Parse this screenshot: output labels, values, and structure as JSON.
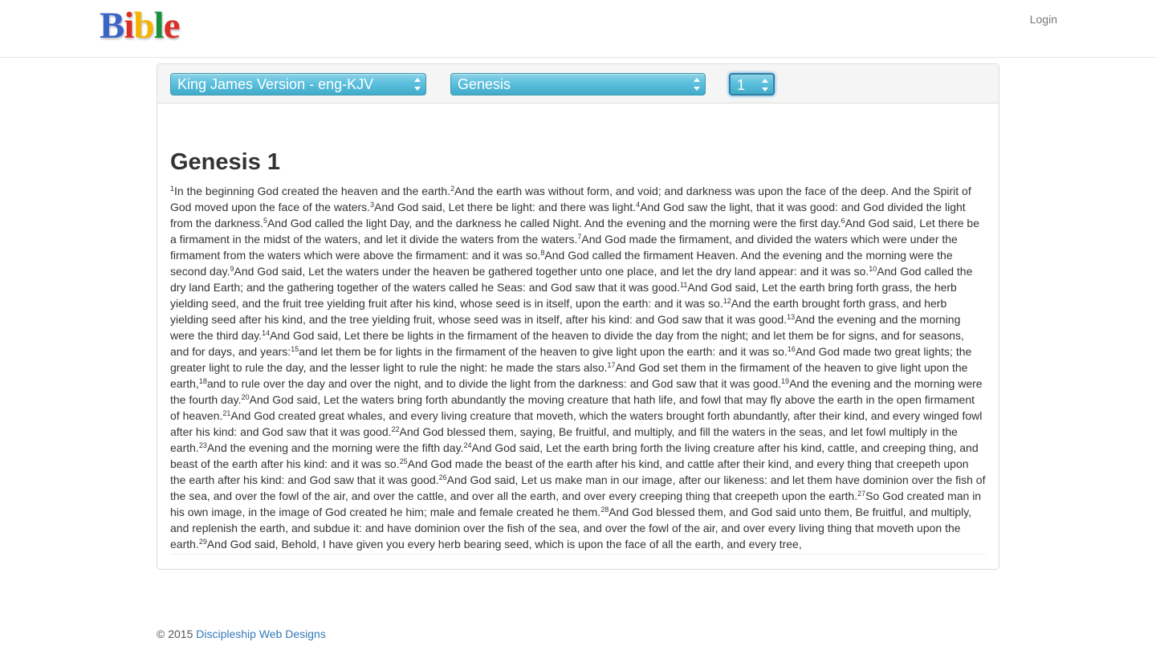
{
  "header": {
    "logo_letters": [
      {
        "ch": "B",
        "color": "#3b64c8"
      },
      {
        "ch": "i",
        "color": "#d93025"
      },
      {
        "ch": "b",
        "color": "#f4b400"
      },
      {
        "ch": "l",
        "color": "#1a8f3c"
      },
      {
        "ch": "e",
        "color": "#d93025"
      }
    ],
    "login_label": "Login"
  },
  "selectors": {
    "version": "King James Version - eng-KJV",
    "book": "Genesis",
    "chapter": "1"
  },
  "chapter_title": "Genesis 1",
  "verses": [
    {
      "n": "1",
      "text": "In the beginning God created the heaven and the earth."
    },
    {
      "n": "2",
      "text": "And the earth was without form, and void; and darkness was upon the face of the deep. And the Spirit of God moved upon the face of the waters."
    },
    {
      "n": "3",
      "text": "And God said, Let there be light: and there was light."
    },
    {
      "n": "4",
      "text": "And God saw the light, that it was good: and God divided the light from the darkness."
    },
    {
      "n": "5",
      "text": "And God called the light Day, and the darkness he called Night. And the evening and the morning were the first day."
    },
    {
      "n": "6",
      "text": "And God said, Let there be a firmament in the midst of the waters, and let it divide the waters from the waters."
    },
    {
      "n": "7",
      "text": "And God made the firmament, and divided the waters which were under the firmament from the waters which were above the firmament: and it was so."
    },
    {
      "n": "8",
      "text": "And God called the firmament Heaven. And the evening and the morning were the second day."
    },
    {
      "n": "9",
      "text": "And God said, Let the waters under the heaven be gathered together unto one place, and let the dry land appear: and it was so."
    },
    {
      "n": "10",
      "text": "And God called the dry land Earth; and the gathering together of the waters called he Seas: and God saw that it was good."
    },
    {
      "n": "11",
      "text": "And God said, Let the earth bring forth grass, the herb yielding seed, and the fruit tree yielding fruit after his kind, whose seed is in itself, upon the earth: and it was so."
    },
    {
      "n": "12",
      "text": "And the earth brought forth grass, and herb yielding seed after his kind, and the tree yielding fruit, whose seed was in itself, after his kind: and God saw that it was good."
    },
    {
      "n": "13",
      "text": "And the evening and the morning were the third day."
    },
    {
      "n": "14",
      "text": "And God said, Let there be lights in the firmament of the heaven to divide the day from the night; and let them be for signs, and for seasons, and for days, and years:"
    },
    {
      "n": "15",
      "text": "and let them be for lights in the firmament of the heaven to give light upon the earth: and it was so."
    },
    {
      "n": "16",
      "text": "And God made two great lights; the greater light to rule the day, and the lesser light to rule the night: he made the stars also."
    },
    {
      "n": "17",
      "text": "And God set them in the firmament of the heaven to give light upon the earth,"
    },
    {
      "n": "18",
      "text": "and to rule over the day and over the night, and to divide the light from the darkness: and God saw that it was good."
    },
    {
      "n": "19",
      "text": "And the evening and the morning were the fourth day."
    },
    {
      "n": "20",
      "text": "And God said, Let the waters bring forth abundantly the moving creature that hath life, and fowl that may fly above the earth in the open firmament of heaven."
    },
    {
      "n": "21",
      "text": "And God created great whales, and every living creature that moveth, which the waters brought forth abundantly, after their kind, and every winged fowl after his kind: and God saw that it was good."
    },
    {
      "n": "22",
      "text": "And God blessed them, saying, Be fruitful, and multiply, and fill the waters in the seas, and let fowl multiply in the earth."
    },
    {
      "n": "23",
      "text": "And the evening and the morning were the fifth day."
    },
    {
      "n": "24",
      "text": "And God said, Let the earth bring forth the living creature after his kind, cattle, and creeping thing, and beast of the earth after his kind: and it was so."
    },
    {
      "n": "25",
      "text": "And God made the beast of the earth after his kind, and cattle after their kind, and every thing that creepeth upon the earth after his kind: and God saw that it was good."
    },
    {
      "n": "26",
      "text": "And God said, Let us make man in our image, after our likeness: and let them have dominion over the fish of the sea, and over the fowl of the air, and over the cattle, and over all the earth, and over every creeping thing that creepeth upon the earth."
    },
    {
      "n": "27",
      "text": "So God created man in his own image, in the image of God created he him; male and female created he them."
    },
    {
      "n": "28",
      "text": "And God blessed them, and God said unto them, Be fruitful, and multiply, and replenish the earth, and subdue it: and have dominion over the fish of the sea, and over the fowl of the air, and over every living thing that moveth upon the earth."
    },
    {
      "n": "29",
      "text": "And God said, Behold, I have given you every herb bearing seed, which is upon the face of all the earth, and every tree,"
    }
  ],
  "footer": {
    "copyright": "© 2015 ",
    "link_label": "Discipleship Web Designs"
  },
  "colors": {
    "select_accent": "#5bc0de",
    "link": "#337ab7"
  }
}
